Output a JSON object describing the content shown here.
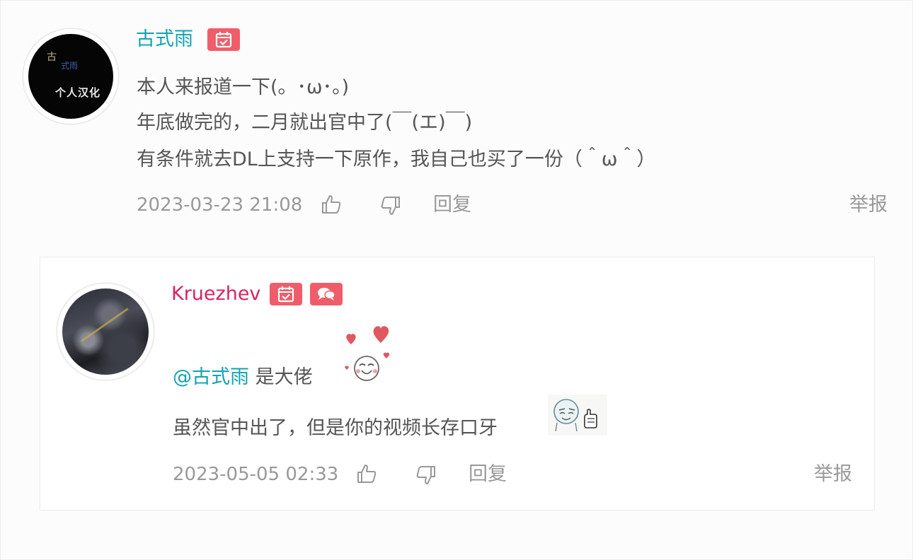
{
  "comment": {
    "username": "古式雨",
    "avatar_text": [
      "古",
      "式雨",
      "个人汉化"
    ],
    "lines": [
      "本人来报道一下(。･ω･。)",
      "年底做完的，二月就出官中了(￣(エ)￣)",
      "有条件就去DL上支持一下原作，我自己也买了一份（＾ω＾）"
    ],
    "timestamp": "2023-03-23 21:08",
    "reply_label": "回复",
    "report_label": "举报",
    "badges": [
      "calendar-check-icon"
    ]
  },
  "reply": {
    "username": "Kruezhev",
    "mention": "@古式雨",
    "line1_rest": " 是大佬",
    "line2": "虽然官中出了，但是你的视频长存口牙",
    "timestamp": "2023-05-05 02:33",
    "reply_label": "回复",
    "report_label": "举报",
    "badges": [
      "calendar-check-icon",
      "chat-bubbles-icon"
    ],
    "emotes": [
      "love-hearts-emote",
      "thumbs-up-emote"
    ]
  },
  "colors": {
    "username_teal": "#11a3b3",
    "username_pink": "#d6245e",
    "badge_red": "#ef5d6a",
    "meta_gray": "#999999"
  }
}
